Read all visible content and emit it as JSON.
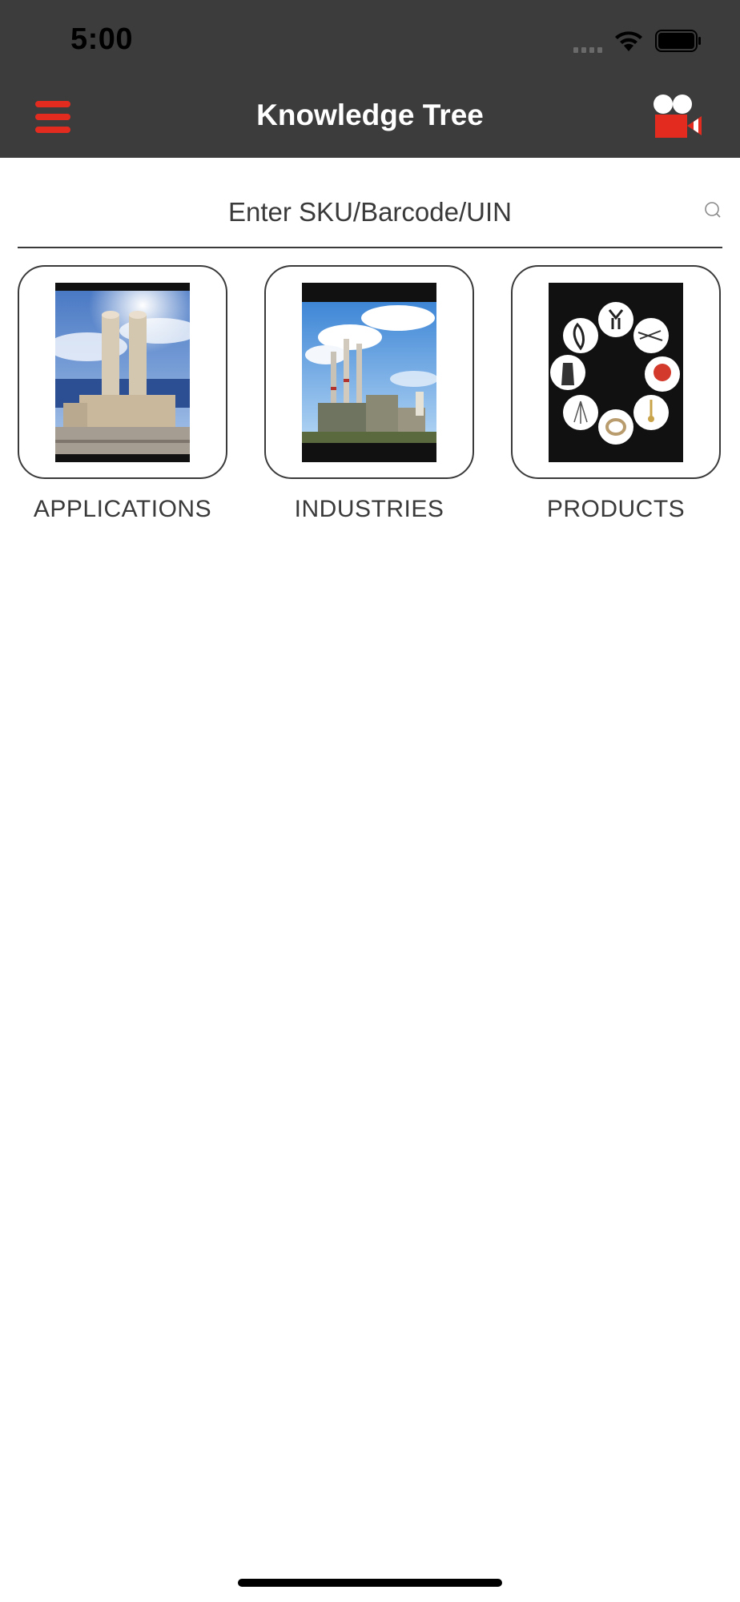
{
  "status_bar": {
    "time": "5:00"
  },
  "header": {
    "title": "Knowledge Tree",
    "menu_icon": "hamburger-menu-icon",
    "video_icon": "video-camera-icon"
  },
  "search": {
    "placeholder": "Enter SKU/Barcode/UIN",
    "icon": "search-icon"
  },
  "tiles": [
    {
      "label": "APPLICATIONS",
      "icon": "silo-construction-photo"
    },
    {
      "label": "INDUSTRIES",
      "icon": "power-plant-smokestacks-photo"
    },
    {
      "label": "PRODUCTS",
      "icon": "fall-protection-equipment-photo"
    }
  ],
  "colors": {
    "header_bg": "#3c3c3c",
    "accent": "#e42b1f",
    "text": "#3a3a3a"
  }
}
